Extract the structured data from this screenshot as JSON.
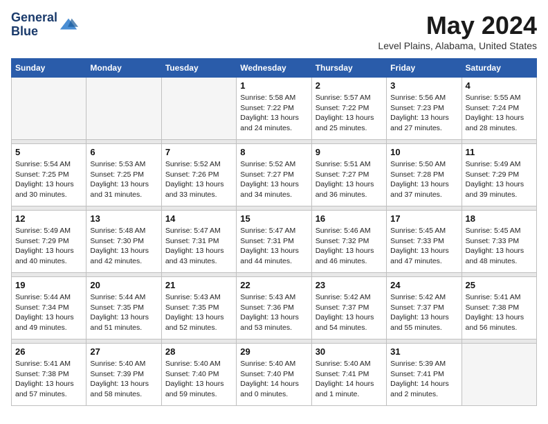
{
  "header": {
    "logo_line1": "General",
    "logo_line2": "Blue",
    "month_title": "May 2024",
    "location": "Level Plains, Alabama, United States"
  },
  "weekdays": [
    "Sunday",
    "Monday",
    "Tuesday",
    "Wednesday",
    "Thursday",
    "Friday",
    "Saturday"
  ],
  "weeks": [
    [
      {
        "day": "",
        "info": ""
      },
      {
        "day": "",
        "info": ""
      },
      {
        "day": "",
        "info": ""
      },
      {
        "day": "1",
        "info": "Sunrise: 5:58 AM\nSunset: 7:22 PM\nDaylight: 13 hours\nand 24 minutes."
      },
      {
        "day": "2",
        "info": "Sunrise: 5:57 AM\nSunset: 7:22 PM\nDaylight: 13 hours\nand 25 minutes."
      },
      {
        "day": "3",
        "info": "Sunrise: 5:56 AM\nSunset: 7:23 PM\nDaylight: 13 hours\nand 27 minutes."
      },
      {
        "day": "4",
        "info": "Sunrise: 5:55 AM\nSunset: 7:24 PM\nDaylight: 13 hours\nand 28 minutes."
      }
    ],
    [
      {
        "day": "5",
        "info": "Sunrise: 5:54 AM\nSunset: 7:25 PM\nDaylight: 13 hours\nand 30 minutes."
      },
      {
        "day": "6",
        "info": "Sunrise: 5:53 AM\nSunset: 7:25 PM\nDaylight: 13 hours\nand 31 minutes."
      },
      {
        "day": "7",
        "info": "Sunrise: 5:52 AM\nSunset: 7:26 PM\nDaylight: 13 hours\nand 33 minutes."
      },
      {
        "day": "8",
        "info": "Sunrise: 5:52 AM\nSunset: 7:27 PM\nDaylight: 13 hours\nand 34 minutes."
      },
      {
        "day": "9",
        "info": "Sunrise: 5:51 AM\nSunset: 7:27 PM\nDaylight: 13 hours\nand 36 minutes."
      },
      {
        "day": "10",
        "info": "Sunrise: 5:50 AM\nSunset: 7:28 PM\nDaylight: 13 hours\nand 37 minutes."
      },
      {
        "day": "11",
        "info": "Sunrise: 5:49 AM\nSunset: 7:29 PM\nDaylight: 13 hours\nand 39 minutes."
      }
    ],
    [
      {
        "day": "12",
        "info": "Sunrise: 5:49 AM\nSunset: 7:29 PM\nDaylight: 13 hours\nand 40 minutes."
      },
      {
        "day": "13",
        "info": "Sunrise: 5:48 AM\nSunset: 7:30 PM\nDaylight: 13 hours\nand 42 minutes."
      },
      {
        "day": "14",
        "info": "Sunrise: 5:47 AM\nSunset: 7:31 PM\nDaylight: 13 hours\nand 43 minutes."
      },
      {
        "day": "15",
        "info": "Sunrise: 5:47 AM\nSunset: 7:31 PM\nDaylight: 13 hours\nand 44 minutes."
      },
      {
        "day": "16",
        "info": "Sunrise: 5:46 AM\nSunset: 7:32 PM\nDaylight: 13 hours\nand 46 minutes."
      },
      {
        "day": "17",
        "info": "Sunrise: 5:45 AM\nSunset: 7:33 PM\nDaylight: 13 hours\nand 47 minutes."
      },
      {
        "day": "18",
        "info": "Sunrise: 5:45 AM\nSunset: 7:33 PM\nDaylight: 13 hours\nand 48 minutes."
      }
    ],
    [
      {
        "day": "19",
        "info": "Sunrise: 5:44 AM\nSunset: 7:34 PM\nDaylight: 13 hours\nand 49 minutes."
      },
      {
        "day": "20",
        "info": "Sunrise: 5:44 AM\nSunset: 7:35 PM\nDaylight: 13 hours\nand 51 minutes."
      },
      {
        "day": "21",
        "info": "Sunrise: 5:43 AM\nSunset: 7:35 PM\nDaylight: 13 hours\nand 52 minutes."
      },
      {
        "day": "22",
        "info": "Sunrise: 5:43 AM\nSunset: 7:36 PM\nDaylight: 13 hours\nand 53 minutes."
      },
      {
        "day": "23",
        "info": "Sunrise: 5:42 AM\nSunset: 7:37 PM\nDaylight: 13 hours\nand 54 minutes."
      },
      {
        "day": "24",
        "info": "Sunrise: 5:42 AM\nSunset: 7:37 PM\nDaylight: 13 hours\nand 55 minutes."
      },
      {
        "day": "25",
        "info": "Sunrise: 5:41 AM\nSunset: 7:38 PM\nDaylight: 13 hours\nand 56 minutes."
      }
    ],
    [
      {
        "day": "26",
        "info": "Sunrise: 5:41 AM\nSunset: 7:38 PM\nDaylight: 13 hours\nand 57 minutes."
      },
      {
        "day": "27",
        "info": "Sunrise: 5:40 AM\nSunset: 7:39 PM\nDaylight: 13 hours\nand 58 minutes."
      },
      {
        "day": "28",
        "info": "Sunrise: 5:40 AM\nSunset: 7:40 PM\nDaylight: 13 hours\nand 59 minutes."
      },
      {
        "day": "29",
        "info": "Sunrise: 5:40 AM\nSunset: 7:40 PM\nDaylight: 14 hours\nand 0 minutes."
      },
      {
        "day": "30",
        "info": "Sunrise: 5:40 AM\nSunset: 7:41 PM\nDaylight: 14 hours\nand 1 minute."
      },
      {
        "day": "31",
        "info": "Sunrise: 5:39 AM\nSunset: 7:41 PM\nDaylight: 14 hours\nand 2 minutes."
      },
      {
        "day": "",
        "info": ""
      }
    ]
  ]
}
